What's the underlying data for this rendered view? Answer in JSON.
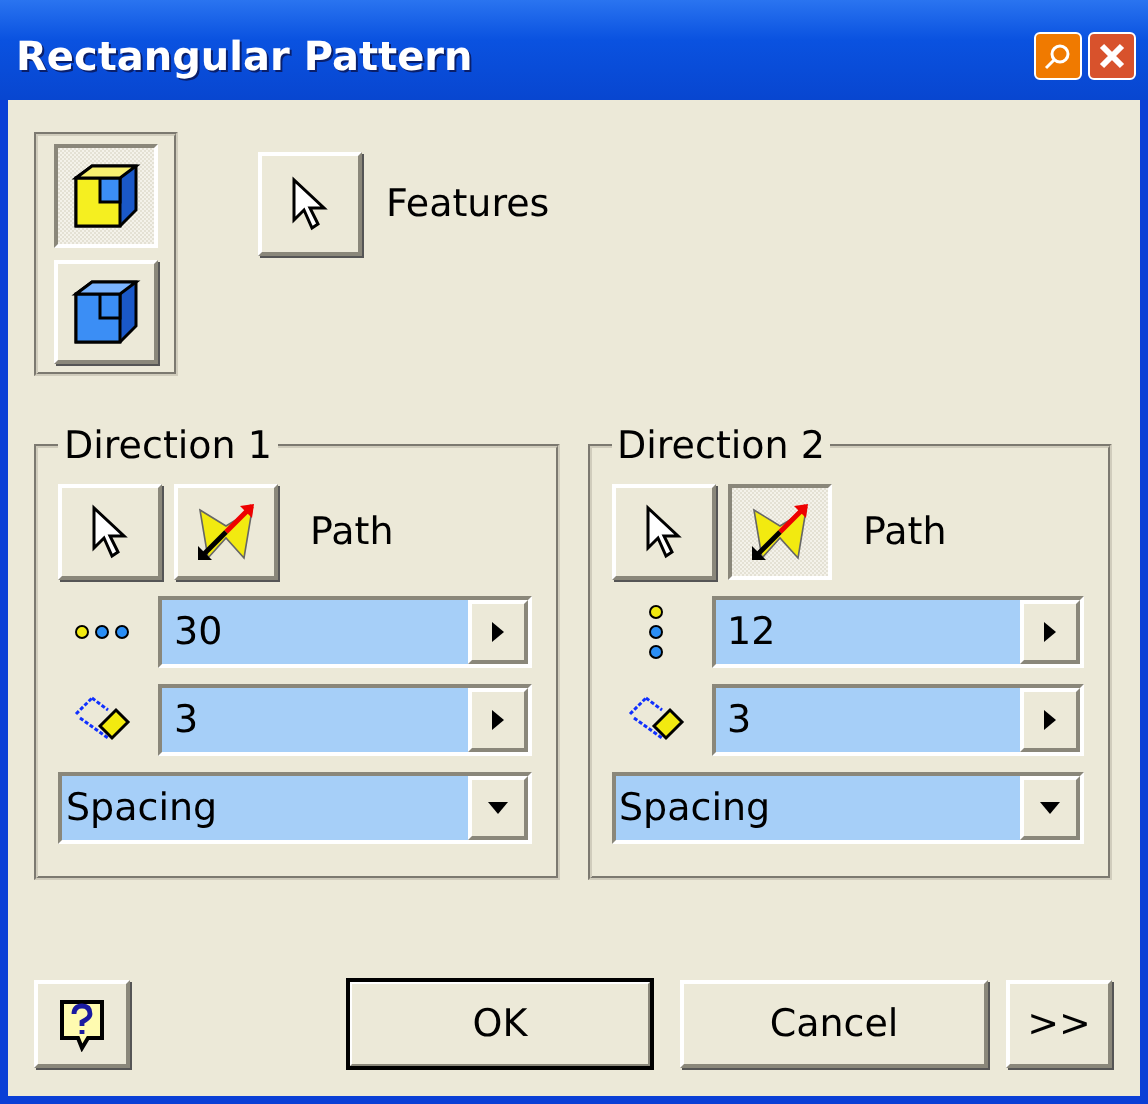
{
  "window": {
    "title": "Rectangular Pattern"
  },
  "output_buttons": [
    {
      "kind": "solid",
      "selected": true
    },
    {
      "kind": "surface",
      "selected": false
    }
  ],
  "features": {
    "label": "Features"
  },
  "directions": [
    {
      "title": "Direction 1",
      "path_label": "Path",
      "path_selected": false,
      "kind": "horizontal",
      "count": "30",
      "spacing": "3",
      "method": "Spacing"
    },
    {
      "title": "Direction 2",
      "path_label": "Path",
      "path_selected": true,
      "kind": "vertical",
      "count": "12",
      "spacing": "3",
      "method": "Spacing"
    }
  ],
  "buttons": {
    "ok": "OK",
    "cancel": "Cancel",
    "more": ">>"
  }
}
